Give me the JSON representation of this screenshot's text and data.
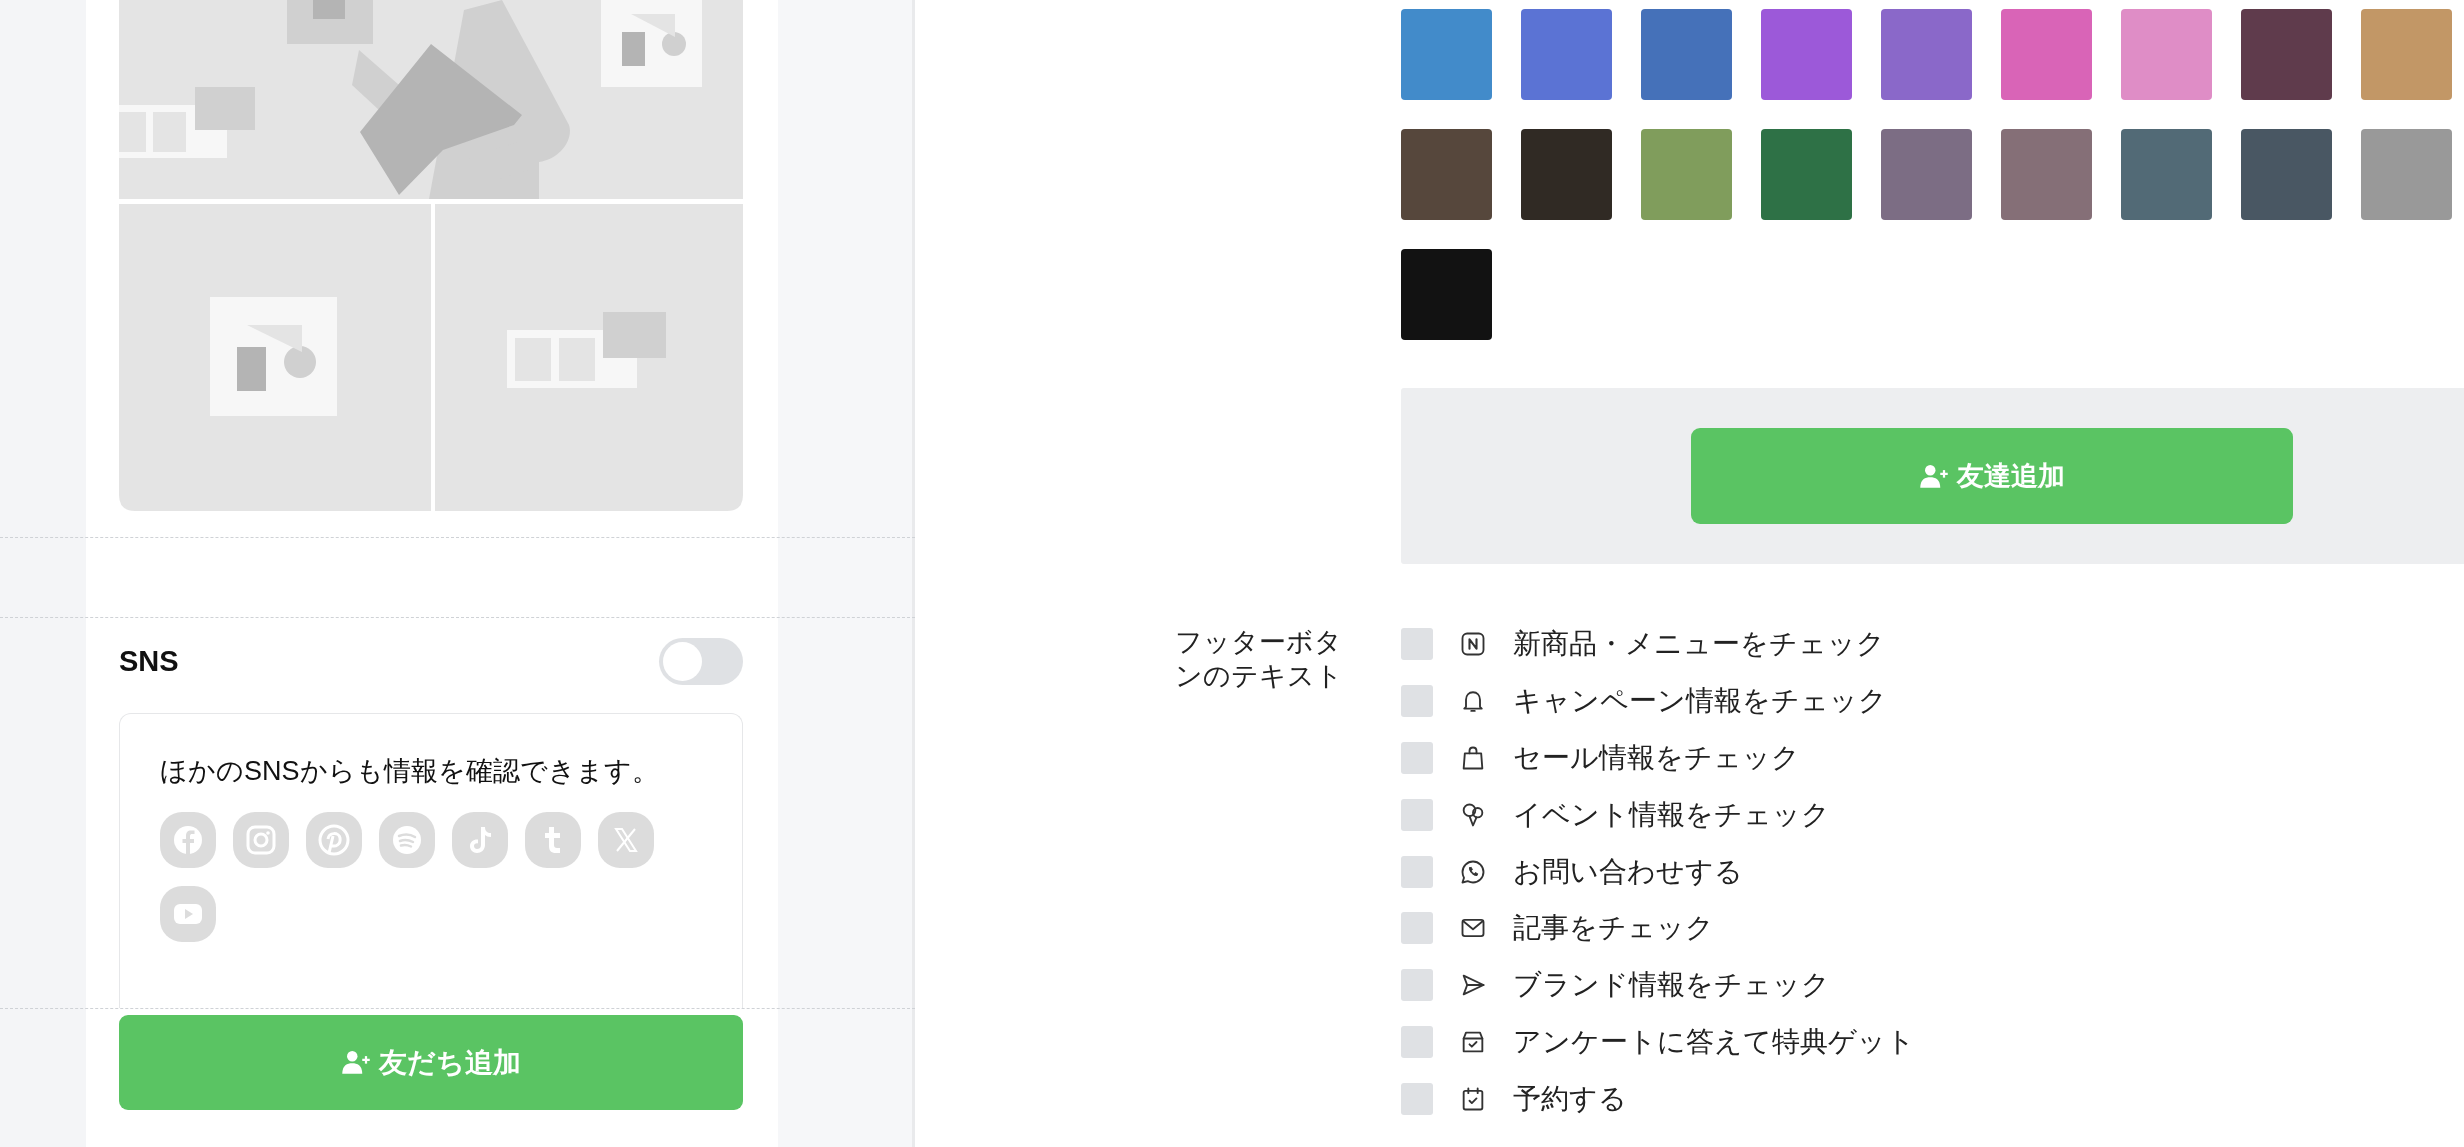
{
  "preview": {
    "sns": {
      "title": "SNS",
      "on": false,
      "message": "ほかのSNSからも情報を確認できます。",
      "icons": [
        {
          "kind": "facebook"
        },
        {
          "kind": "instagram"
        },
        {
          "kind": "pinterest"
        },
        {
          "kind": "spotify"
        },
        {
          "kind": "tiktok"
        },
        {
          "kind": "tumblr"
        },
        {
          "kind": "x"
        },
        {
          "kind": "youtube"
        }
      ]
    },
    "add_friend_button": {
      "label": "友だち追加"
    }
  },
  "settings": {
    "swatches": [
      {
        "color": "#428bca"
      },
      {
        "color": "#5b73d4"
      },
      {
        "color": "#4571b9"
      },
      {
        "color": "#9c59d9"
      },
      {
        "color": "#8a68c9"
      },
      {
        "color": "#d964b7"
      },
      {
        "color": "#df8dc6"
      },
      {
        "color": "#5f3b4c"
      },
      {
        "color": "#c29766"
      },
      {
        "color": "#56473c"
      },
      {
        "color": "#302a24"
      },
      {
        "color": "#809d5c"
      },
      {
        "color": "#2e7146"
      },
      {
        "color": "#7c6d84"
      },
      {
        "color": "#856f77"
      },
      {
        "color": "#526a76"
      },
      {
        "color": "#495763"
      },
      {
        "color": "#999999"
      },
      {
        "color": "#121212"
      }
    ],
    "preview_button": {
      "label": "友達追加"
    },
    "footer_buttons": {
      "label": "フッターボタンのテキスト",
      "items": [
        {
          "kind": "news",
          "label": "新商品・メニューをチェック",
          "checked": false
        },
        {
          "kind": "bell",
          "label": "キャンペーン情報をチェック",
          "checked": false
        },
        {
          "kind": "bag",
          "label": "セール情報をチェック",
          "checked": false
        },
        {
          "kind": "balloon",
          "label": "イベント情報をチェック",
          "checked": false
        },
        {
          "kind": "chat",
          "label": "お問い合わせする",
          "checked": false
        },
        {
          "kind": "mail",
          "label": "記事をチェック",
          "checked": false
        },
        {
          "kind": "send",
          "label": "ブランド情報をチェック",
          "checked": false
        },
        {
          "kind": "box",
          "label": "アンケートに答えて特典ゲット",
          "checked": false
        },
        {
          "kind": "calendar",
          "label": "予約する",
          "checked": false
        }
      ]
    }
  }
}
